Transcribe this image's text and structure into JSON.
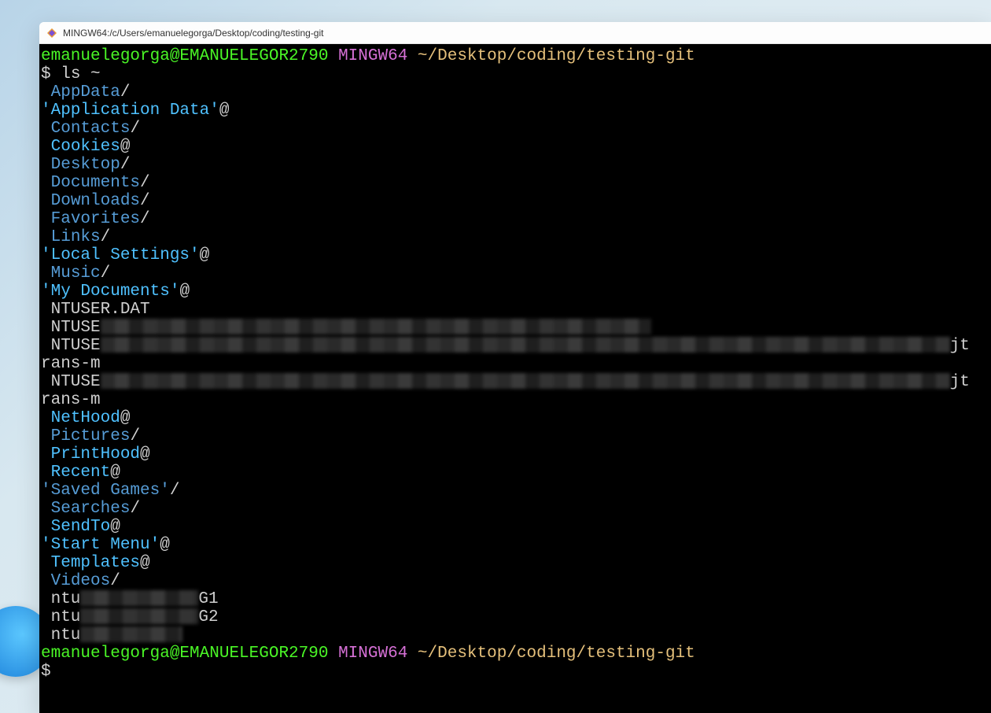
{
  "titlebar": {
    "title": "MINGW64:/c/Users/emanuelegorga/Desktop/coding/testing-git"
  },
  "prompt1": {
    "user_host": "emanuelegorga@EMANUELEGOR2790",
    "env": "MINGW64",
    "path": "~/Desktop/coding/testing-git",
    "symbol": "$",
    "command": "ls ~"
  },
  "listing": [
    {
      "indent": " ",
      "name": "AppData",
      "suffix": "/",
      "color": "blue"
    },
    {
      "indent": "",
      "name": "'Application Data'",
      "suffix": "@",
      "color": "cyan"
    },
    {
      "indent": " ",
      "name": "Contacts",
      "suffix": "/",
      "color": "blue"
    },
    {
      "indent": " ",
      "name": "Cookies",
      "suffix": "@",
      "color": "cyan"
    },
    {
      "indent": " ",
      "name": "Desktop",
      "suffix": "/",
      "color": "blue"
    },
    {
      "indent": " ",
      "name": "Documents",
      "suffix": "/",
      "color": "blue"
    },
    {
      "indent": " ",
      "name": "Downloads",
      "suffix": "/",
      "color": "blue"
    },
    {
      "indent": " ",
      "name": "Favorites",
      "suffix": "/",
      "color": "blue"
    },
    {
      "indent": " ",
      "name": "Links",
      "suffix": "/",
      "color": "blue"
    },
    {
      "indent": "",
      "name": "'Local Settings'",
      "suffix": "@",
      "color": "cyan"
    },
    {
      "indent": " ",
      "name": "Music",
      "suffix": "/",
      "color": "blue"
    },
    {
      "indent": "",
      "name": "'My Documents'",
      "suffix": "@",
      "color": "cyan"
    }
  ],
  "ntuser_lines": [
    {
      "prefix": " NTUSER.DAT",
      "censor_w": 0,
      "tail": ""
    },
    {
      "prefix": " NTUSE",
      "censor_w": 700,
      "tail": ""
    },
    {
      "prefix": " NTUSE",
      "censor_w": 1080,
      "tail": "jt"
    },
    {
      "prefix": "rans-m",
      "censor_w": 0,
      "tail": ""
    },
    {
      "prefix": " NTUSE",
      "censor_w": 1080,
      "tail": "jt"
    },
    {
      "prefix": "rans-m",
      "censor_w": 0,
      "tail": ""
    }
  ],
  "listing2": [
    {
      "indent": " ",
      "name": "NetHood",
      "suffix": "@",
      "color": "cyan"
    },
    {
      "indent": " ",
      "name": "Pictures",
      "suffix": "/",
      "color": "blue"
    },
    {
      "indent": " ",
      "name": "PrintHood",
      "suffix": "@",
      "color": "cyan"
    },
    {
      "indent": " ",
      "name": "Recent",
      "suffix": "@",
      "color": "cyan"
    },
    {
      "indent": "",
      "name": "'Saved Games'",
      "suffix": "/",
      "color": "blue"
    },
    {
      "indent": " ",
      "name": "Searches",
      "suffix": "/",
      "color": "blue"
    },
    {
      "indent": " ",
      "name": "SendTo",
      "suffix": "@",
      "color": "cyan"
    },
    {
      "indent": "",
      "name": "'Start Menu'",
      "suffix": "@",
      "color": "cyan"
    },
    {
      "indent": " ",
      "name": "Templates",
      "suffix": "@",
      "color": "cyan"
    },
    {
      "indent": " ",
      "name": "Videos",
      "suffix": "/",
      "color": "blue"
    }
  ],
  "ntuser_tail": [
    {
      "prefix": " ntu",
      "censor_w": 150,
      "tail": "G1"
    },
    {
      "prefix": " ntu",
      "censor_w": 150,
      "tail": "G2"
    },
    {
      "prefix": " ntu",
      "censor_w": 130,
      "tail": ""
    }
  ],
  "prompt2": {
    "user_host": "emanuelegorga@EMANUELEGOR2790",
    "env": "MINGW64",
    "path": "~/Desktop/coding/testing-git",
    "symbol": "$"
  }
}
